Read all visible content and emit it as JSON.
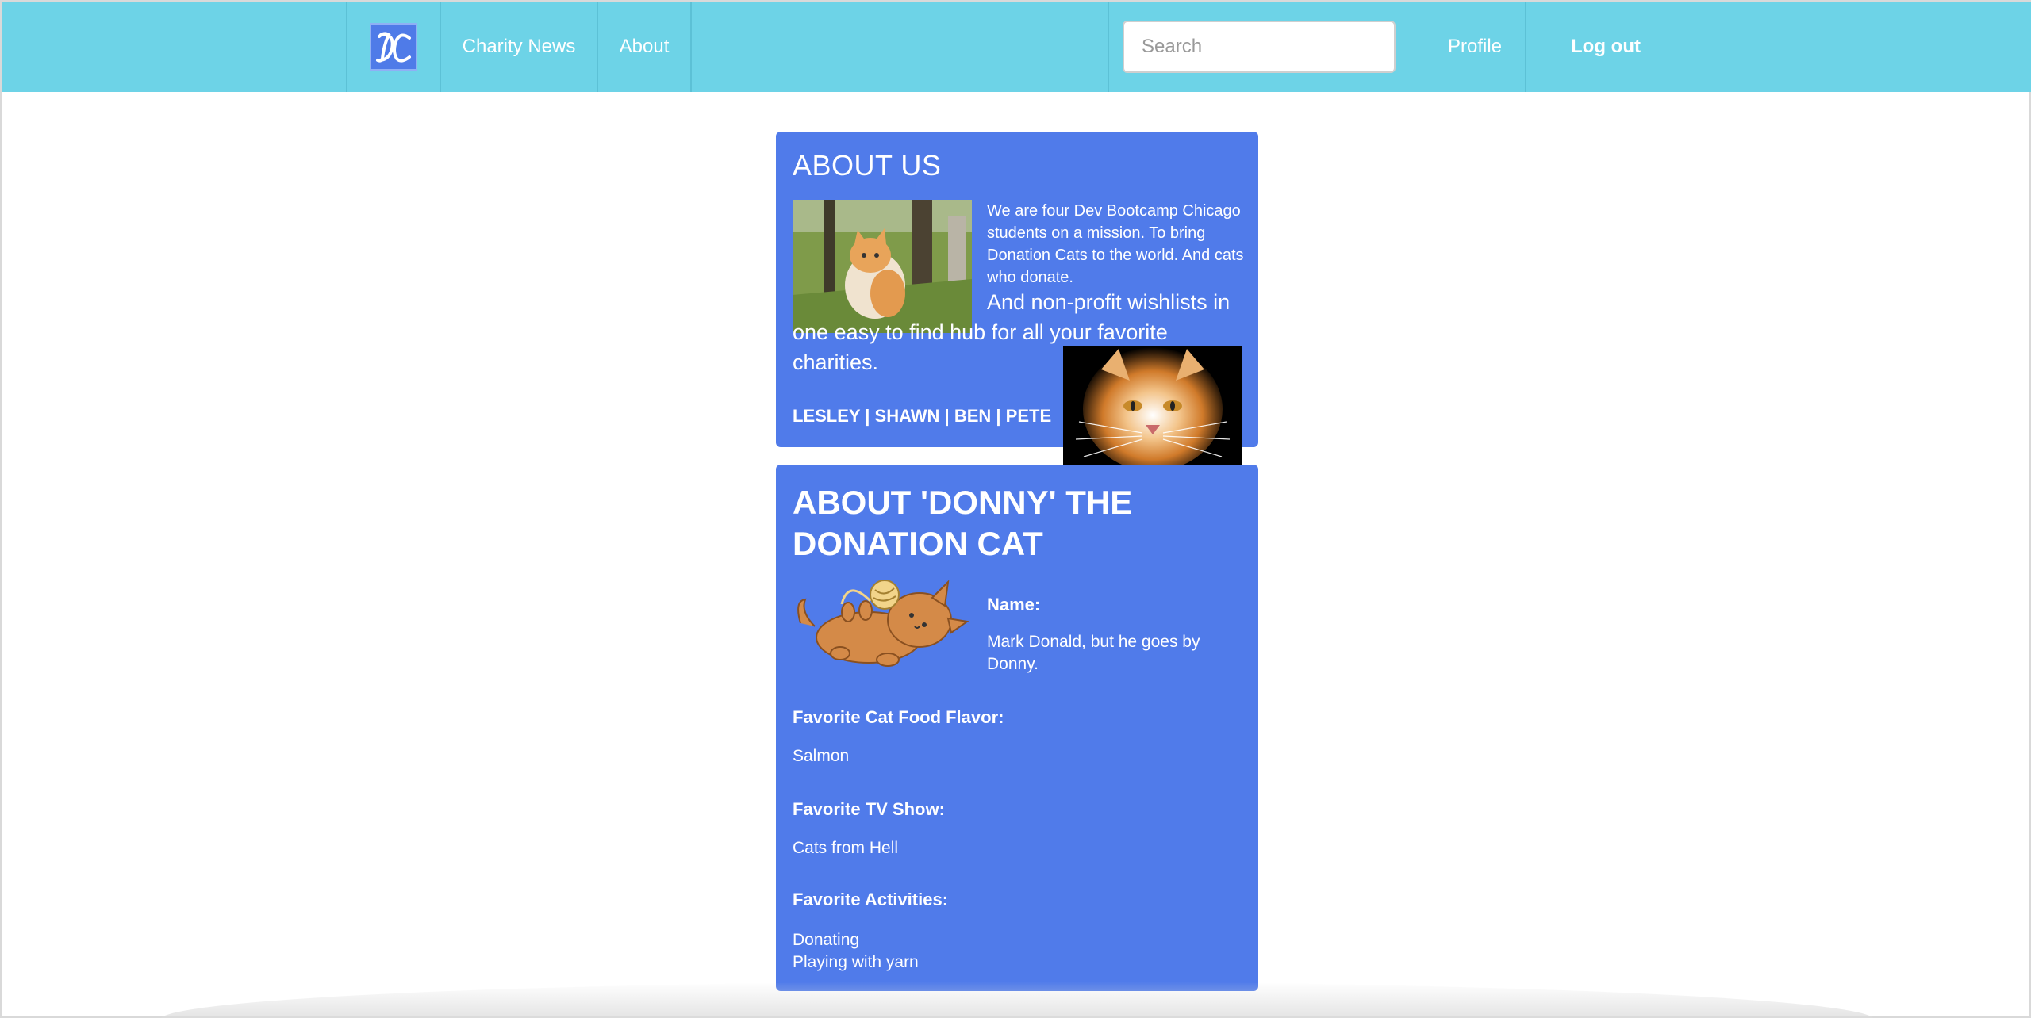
{
  "nav": {
    "brand_icon": "dc-logo-icon",
    "brand_color": "#4f7be8",
    "bar_color": "#6dd3e7",
    "links": {
      "charity_news": "Charity News",
      "about": "About",
      "profile": "Profile",
      "logout": "Log out"
    },
    "search": {
      "placeholder": "Search",
      "value": ""
    }
  },
  "about_us": {
    "title": "ABOUT US",
    "intro": "We are four Dev Bootcamp Chicago students on a mission. To bring Donation Cats to the world. And cats who donate.",
    "tagline": "And non-profit wishlists in one easy to find hub for all your favorite charities.",
    "names": "LESLEY | SHAWN | BEN | PETE",
    "card_color": "#507bea"
  },
  "donny": {
    "title": "ABOUT 'DONNY' THE DONATION CAT",
    "name_label": "Name:",
    "name_value": "Mark Donald, but he goes by Donny.",
    "food_label": "Favorite Cat Food Flavor:",
    "food_value": "Salmon",
    "tv_label": "Favorite TV Show:",
    "tv_value": "Cats from Hell",
    "activities_label": "Favorite Activities:",
    "activities": [
      "Donating",
      "Playing with yarn"
    ]
  }
}
